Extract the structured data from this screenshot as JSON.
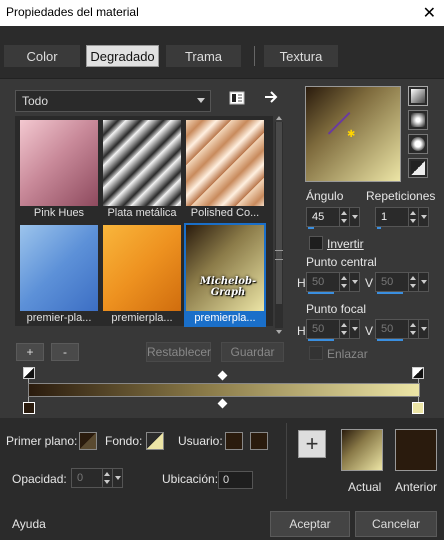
{
  "window": {
    "title": "Propiedades del material"
  },
  "tabs": [
    {
      "label": "Color"
    },
    {
      "label": "Degradado"
    },
    {
      "label": "Trama"
    },
    {
      "label": "Textura"
    }
  ],
  "library": {
    "filter": "Todo",
    "items": [
      {
        "caption": "Pink Hues"
      },
      {
        "caption": "Plata metálica"
      },
      {
        "caption": "Polished Co..."
      },
      {
        "caption": "premier-pla..."
      },
      {
        "caption": "premierpla..."
      },
      {
        "caption": "premierpla..."
      }
    ],
    "watermark": "Michelob-Graph",
    "add_label": "+",
    "remove_label": "-",
    "reset_label": "Restablecer",
    "save_label": "Guardar"
  },
  "gradient": {
    "angle_label": "Ángulo",
    "angle_value": "45",
    "repeat_label": "Repeticiones",
    "repeat_value": "1",
    "invert_label": "Invertir",
    "center_label": "Punto central",
    "focal_label": "Punto focal",
    "h_label": "H",
    "v_label": "V",
    "center_h": "50",
    "center_v": "50",
    "focal_h": "50",
    "focal_v": "50",
    "link_label": "Enlazar"
  },
  "stop_controls": {
    "foreground_label": "Primer plano:",
    "background_label": "Fondo:",
    "user_label": "Usuario:",
    "opacity_label": "Opacidad:",
    "opacity_value": "0",
    "location_label": "Ubicación:",
    "location_value": "0"
  },
  "preview_swatches": {
    "current_label": "Actual",
    "previous_label": "Anterior"
  },
  "footer": {
    "help_label": "Ayuda",
    "accept_label": "Aceptar",
    "cancel_label": "Cancelar"
  },
  "colors": {
    "dark_stop": "#2a1b0d",
    "light_stop": "#ece5a6",
    "selection": "#1a6fc9"
  }
}
